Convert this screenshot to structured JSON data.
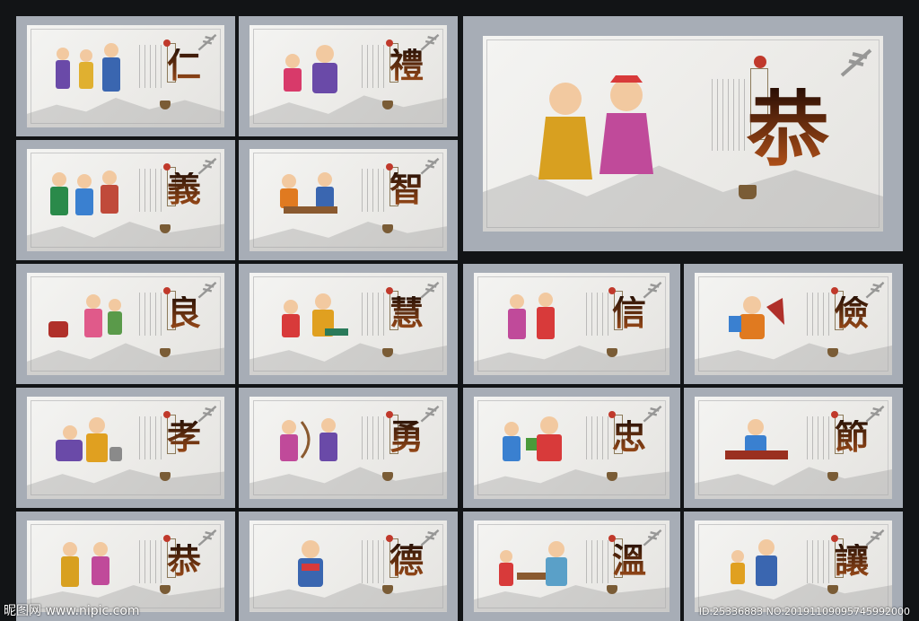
{
  "featured": {
    "char": "恭"
  },
  "cards": [
    {
      "id": "ren",
      "char": "仁"
    },
    {
      "id": "li",
      "char": "禮"
    },
    {
      "id": "yi",
      "char": "義"
    },
    {
      "id": "zhi",
      "char": "智"
    },
    {
      "id": "liang",
      "char": "良"
    },
    {
      "id": "hui",
      "char": "慧"
    },
    {
      "id": "xin",
      "char": "信"
    },
    {
      "id": "jian",
      "char": "儉"
    },
    {
      "id": "xiao",
      "char": "孝"
    },
    {
      "id": "yong",
      "char": "勇"
    },
    {
      "id": "zhong",
      "char": "忠"
    },
    {
      "id": "jie",
      "char": "節"
    },
    {
      "id": "gong",
      "char": "恭"
    },
    {
      "id": "de",
      "char": "德"
    },
    {
      "id": "wen",
      "char": "溫"
    },
    {
      "id": "rang",
      "char": "讓"
    }
  ],
  "watermark": {
    "left": "昵图网 www.nipic.com",
    "right": "ID:25336883 NO:20191109095745992000"
  },
  "colors": {
    "panel_frame": "#a7adb6",
    "background": "#121416",
    "seal_red": "#c0392b"
  }
}
